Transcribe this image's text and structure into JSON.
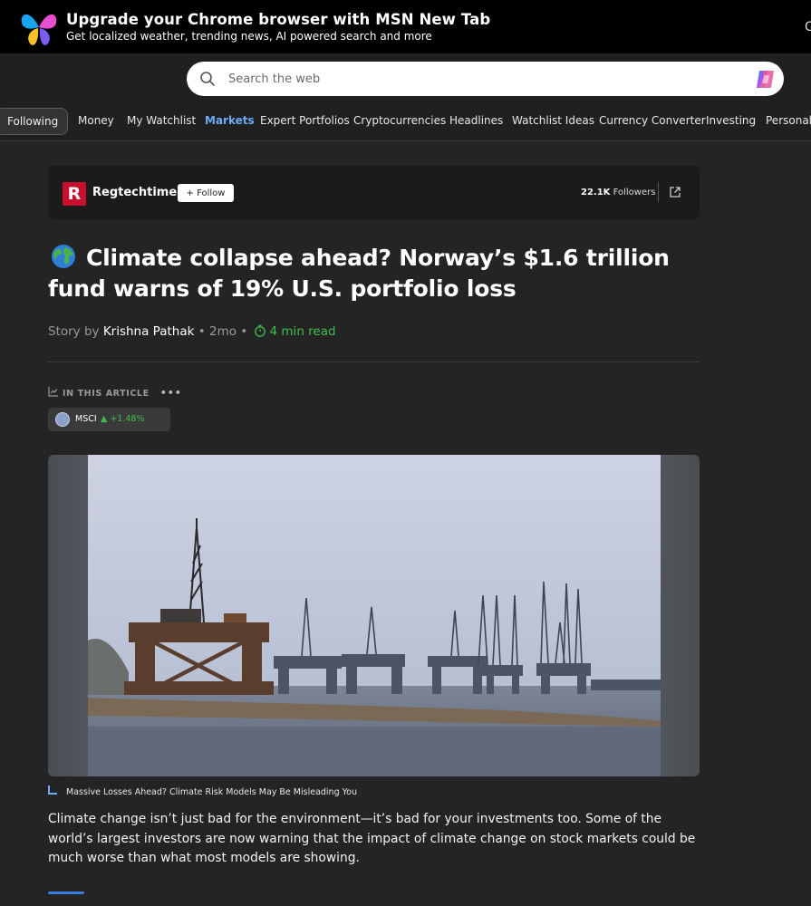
{
  "promo": {
    "title": "Upgrade your Chrome browser with MSN New Tab",
    "subtitle": "Get localized weather, trending news, AI powered search and more",
    "cut_text": "C"
  },
  "search": {
    "placeholder": "Search the web"
  },
  "nav": {
    "following": "Following",
    "items": [
      "Money",
      "My Watchlist",
      "Markets",
      "Expert Portfolios",
      "Cryptocurrencies",
      "Headlines",
      "Watchlist Ideas",
      "Currency Converter",
      "Investing",
      "Personal F"
    ],
    "active": "Markets"
  },
  "publisher": {
    "logo_letter": "R",
    "name": "Regtechtimes",
    "follow_label": "+ Follow",
    "followers_count": "22.1K",
    "followers_label": "Followers"
  },
  "article": {
    "title": "Climate collapse ahead? Norway’s $1.6 trillion fund warns of 19% U.S. portfolio loss",
    "story_by": "Story by",
    "author": "Krishna Pathak",
    "sep1": " • 2mo • ",
    "age": "2mo",
    "read_time": "4 min read",
    "in_this_article": "IN THIS ARTICLE",
    "ticker": {
      "name": "MSCI",
      "change": "▲ +1.48%"
    },
    "caption": "Massive Losses Ahead? Climate Risk Models May Be Misleading You",
    "body": "Climate change isn’t just bad for the environment—it’s bad for your investments too. Some of the world’s largest investors are now warning that the impact of climate change on stock markets could be much worse than what most models are showing."
  },
  "colors": {
    "accent_blue": "#6eaaf5",
    "positive_green": "#3fbf4f",
    "publisher_red": "#c8102e"
  }
}
